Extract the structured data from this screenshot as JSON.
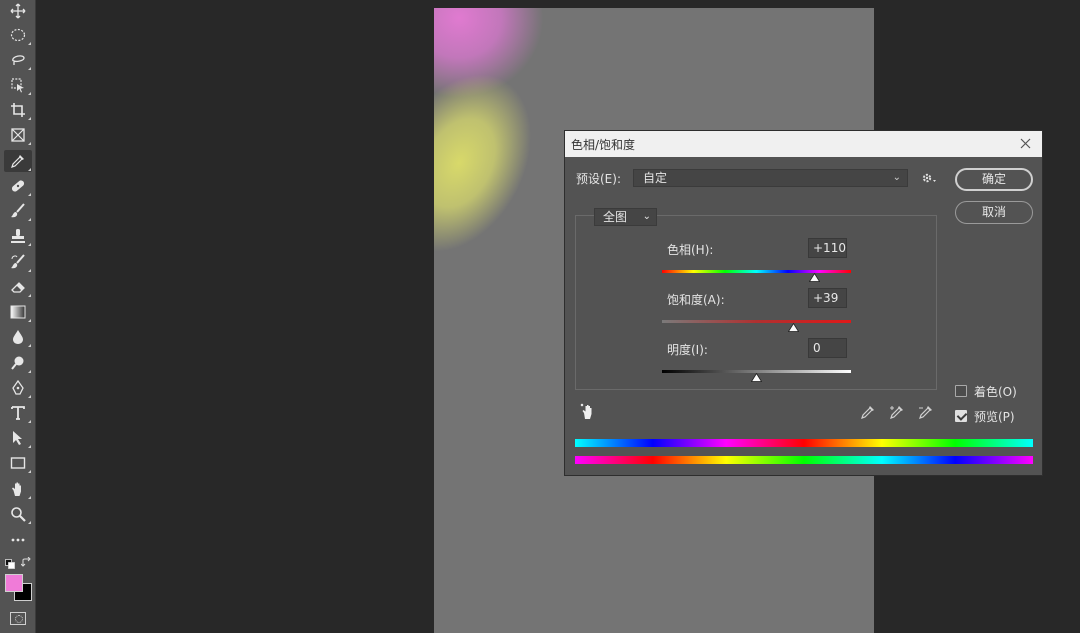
{
  "toolbar": {
    "tools": [
      {
        "name": "move-tool",
        "icon": "move-icon"
      },
      {
        "name": "elliptical-marquee-tool",
        "icon": "ellipse-marquee-icon"
      },
      {
        "name": "lasso-tool",
        "icon": "lasso-icon"
      },
      {
        "name": "object-selection-tool",
        "icon": "object-selection-icon"
      },
      {
        "name": "crop-tool",
        "icon": "crop-icon"
      },
      {
        "name": "frame-tool",
        "icon": "frame-icon"
      },
      {
        "name": "eyedropper-tool",
        "icon": "eyedropper-icon",
        "active": true
      },
      {
        "name": "healing-brush-tool",
        "icon": "bandage-icon"
      },
      {
        "name": "brush-tool",
        "icon": "brush-icon"
      },
      {
        "name": "clone-stamp-tool",
        "icon": "stamp-icon"
      },
      {
        "name": "history-brush-tool",
        "icon": "history-brush-icon"
      },
      {
        "name": "eraser-tool",
        "icon": "eraser-icon"
      },
      {
        "name": "gradient-tool",
        "icon": "gradient-icon"
      },
      {
        "name": "blur-tool",
        "icon": "drop-icon"
      },
      {
        "name": "dodge-tool",
        "icon": "dodge-icon"
      },
      {
        "name": "pen-tool",
        "icon": "pen-icon"
      },
      {
        "name": "type-tool",
        "icon": "type-icon"
      },
      {
        "name": "path-selection-tool",
        "icon": "arrow-icon"
      },
      {
        "name": "rectangle-tool",
        "icon": "rectangle-icon"
      },
      {
        "name": "hand-tool",
        "icon": "hand-icon"
      },
      {
        "name": "zoom-tool",
        "icon": "zoom-icon"
      },
      {
        "name": "edit-toolbar",
        "icon": "more-icon"
      }
    ],
    "foreground_color": "#f07bd8",
    "background_color": "#000000"
  },
  "dialog": {
    "title": "色相/饱和度",
    "preset_label": "预设(E):",
    "preset_value": "自定",
    "channel_value": "全图",
    "ok_label": "确定",
    "cancel_label": "取消",
    "hue": {
      "label": "色相(H):",
      "value": "+110",
      "min": -180,
      "max": 180
    },
    "saturation": {
      "label": "饱和度(A):",
      "value": "+39",
      "min": -100,
      "max": 100
    },
    "lightness": {
      "label": "明度(I):",
      "value": "0",
      "min": -100,
      "max": 100
    },
    "colorize": {
      "label": "着色(O)",
      "checked": false
    },
    "preview": {
      "label": "预览(P)",
      "checked": true
    }
  }
}
